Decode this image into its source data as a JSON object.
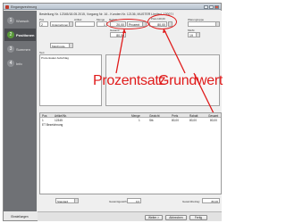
{
  "window": {
    "title": "Eingangsrechnung"
  },
  "sidebar": {
    "items": [
      {
        "number": "1",
        "label": "Wunsch",
        "active": false
      },
      {
        "number": "2",
        "label": "Positionen",
        "active": true
      },
      {
        "number": "3",
        "label": "Summen",
        "active": false
      },
      {
        "number": "4",
        "label": "Info",
        "active": false
      }
    ]
  },
  "header": {
    "info_line": "Bestellung Nr. 12345/18.05.2015, Vorgang Nr. 16 - Kunden Nr. 12136, MUSTER Limited, 12007 Berlin"
  },
  "form": {
    "pos_label": "Pos",
    "pos_value": "2",
    "type_value": "Unternehmen",
    "artikel_label": "Artikel",
    "artikel_value": "Matchcode",
    "menge_label": "Menge",
    "menge_value": "1",
    "rabatt_label": "Rabatt",
    "rabatt_pct_value": "20,00",
    "rabatt_unit": "Prozent",
    "preis_label": "Preis 100,00",
    "preis_value": "80,00",
    "gesamt_label": "Gesamt",
    "gesamt_value": "80,00",
    "mwst_label": "MwSt",
    "mwst_value": "19",
    "warengruppe_label": "Warengruppe",
    "text_label": "Text",
    "text_value": "Prozentualer Aufschlag"
  },
  "annotations": {
    "percent": "Prozentsatz",
    "base": "Grundwert"
  },
  "table": {
    "columns": [
      "Pos",
      "Artikel/Nr.",
      "Menge",
      "Gewicht",
      "Preis",
      "Rabatt",
      "Gesamt"
    ],
    "rows": [
      {
        "pos": "1",
        "artikel": "12345",
        "menge": "1",
        "einheit": "Stk",
        "preis": "80,00",
        "rabatt": "80,00",
        "gesamt": "80,00"
      },
      {
        "pos": "",
        "artikel": "ET Bezeichnung",
        "menge": "",
        "einheit": "",
        "preis": "",
        "rabatt": "",
        "gesamt": ""
      }
    ]
  },
  "bottom": {
    "standard_label": "Standard",
    "gesamtgewicht_label": "Gesamtgewicht:",
    "gesamtgewicht_value": "0,0",
    "gesamtbetrag_label": "Gesamtbetrag:",
    "gesamtbetrag_value": "80,00"
  },
  "footer": {
    "einstellungen": "Einstellungen",
    "weiter": "Weiter >",
    "abbrechen": "Abbrechen",
    "fertig": "Fertig"
  },
  "colors": {
    "annotation": "#e01b1b",
    "sidebar": "#6f7175",
    "active_step": "#5a9a3a"
  }
}
